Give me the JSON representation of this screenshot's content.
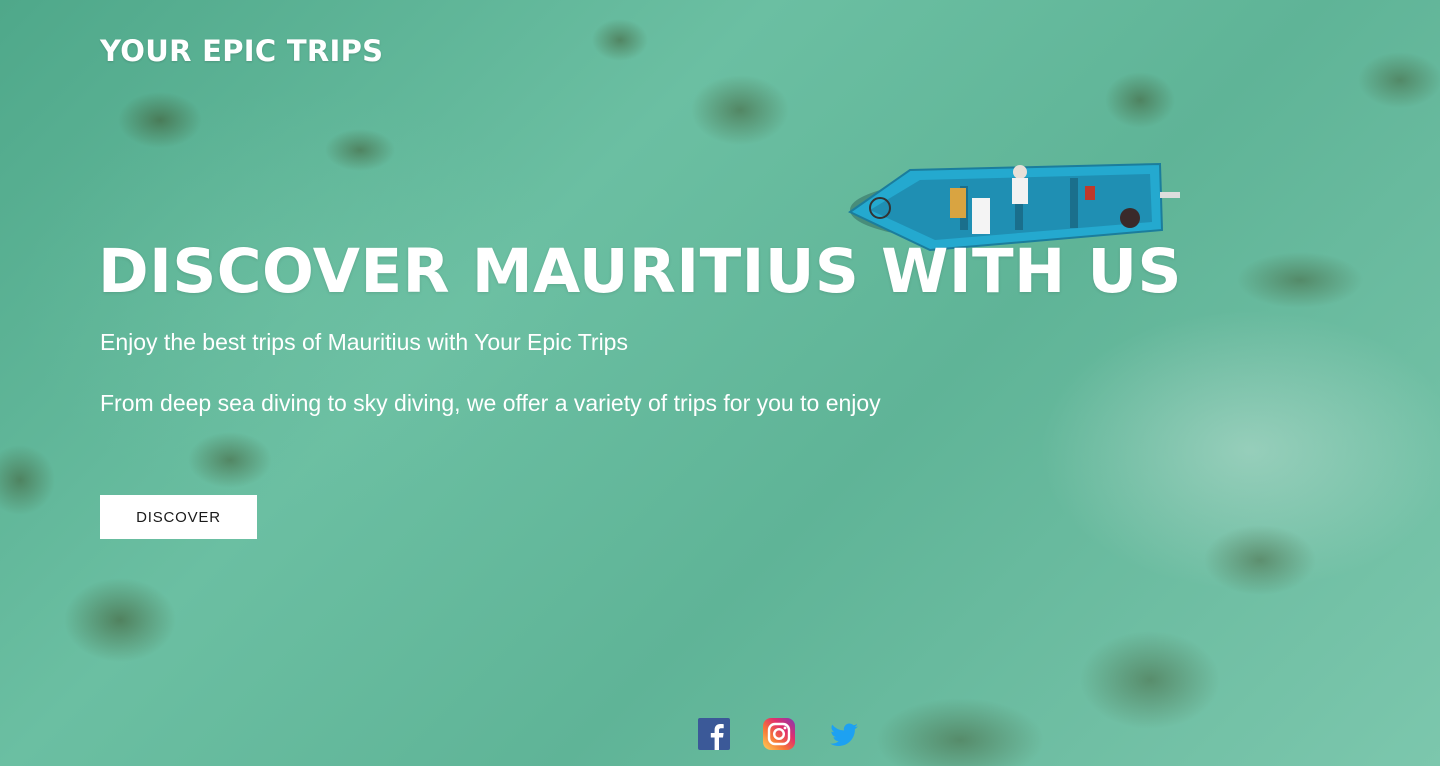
{
  "brand": {
    "logo_text": "YOUR EPIC TRIPS"
  },
  "hero": {
    "headline": "DISCOVER MAURITIUS WITH US",
    "subtitle": "Enjoy the best trips of Mauritius with Your Epic Trips",
    "description": "From deep sea diving to sky diving, we offer a variety of trips for you to enjoy",
    "cta_label": "DISCOVER",
    "background_image": "aerial-ocean-boat"
  },
  "social": [
    {
      "name": "facebook",
      "icon": "facebook-icon",
      "color": "#3b5998"
    },
    {
      "name": "instagram",
      "icon": "instagram-icon",
      "color": "#e1306c"
    },
    {
      "name": "twitter",
      "icon": "twitter-icon",
      "color": "#1da1f2"
    }
  ],
  "colors": {
    "text": "#ffffff",
    "button_bg": "#ffffff",
    "button_text": "#1a1a1a",
    "water": "#5fb497"
  }
}
